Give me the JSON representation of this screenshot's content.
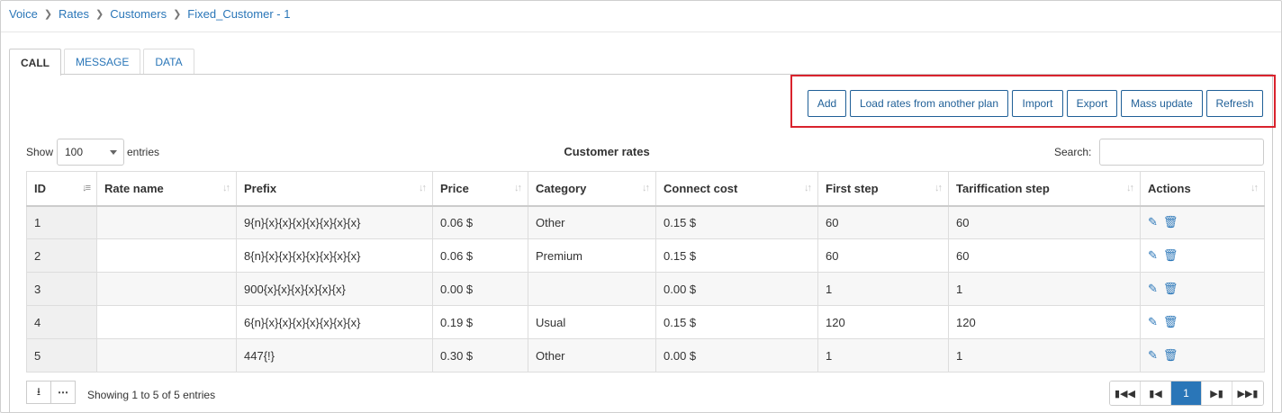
{
  "breadcrumb": [
    "Voice",
    "Rates",
    "Customers",
    "Fixed_Customer - 1"
  ],
  "tabs": [
    {
      "label": "CALL",
      "active": true
    },
    {
      "label": "MESSAGE",
      "active": false
    },
    {
      "label": "DATA",
      "active": false
    }
  ],
  "toolbar": {
    "add": "Add",
    "load": "Load rates from another plan",
    "import": "Import",
    "export": "Export",
    "mass_update": "Mass update",
    "refresh": "Refresh",
    "highlight_color": "#d9232d"
  },
  "table_controls": {
    "show_label": "Show",
    "page_size": "100",
    "entries_label": "entries",
    "title": "Customer rates",
    "search_label": "Search:",
    "search_value": ""
  },
  "columns": [
    "ID",
    "Rate name",
    "Prefix",
    "Price",
    "Category",
    "Connect cost",
    "First step",
    "Tariffication step",
    "Actions"
  ],
  "rows": [
    {
      "id": "1",
      "rate_name": "",
      "prefix": "9{n}{x}{x}{x}{x}{x}{x}{x}",
      "price": "0.06 $",
      "category": "Other",
      "connect_cost": "0.15 $",
      "first_step": "60",
      "tariffication_step": "60"
    },
    {
      "id": "2",
      "rate_name": "",
      "prefix": "8{n}{x}{x}{x}{x}{x}{x}{x}",
      "price": "0.06 $",
      "category": "Premium",
      "connect_cost": "0.15 $",
      "first_step": "60",
      "tariffication_step": "60"
    },
    {
      "id": "3",
      "rate_name": "",
      "prefix": "900{x}{x}{x}{x}{x}{x}",
      "price": "0.00 $",
      "category": "",
      "connect_cost": "0.00 $",
      "first_step": "1",
      "tariffication_step": "1"
    },
    {
      "id": "4",
      "rate_name": "",
      "prefix": "6{n}{x}{x}{x}{x}{x}{x}{x}",
      "price": "0.19 $",
      "category": "Usual",
      "connect_cost": "0.15 $",
      "first_step": "120",
      "tariffication_step": "120"
    },
    {
      "id": "5",
      "rate_name": "",
      "prefix": "447{!}",
      "price": "0.30 $",
      "category": "Other",
      "connect_cost": "0.00 $",
      "first_step": "1",
      "tariffication_step": "1"
    }
  ],
  "row_actions": [
    "edit-icon",
    "delete-icon"
  ],
  "footer": {
    "showing": "Showing 1 to 5 of 5 entries",
    "current_page": "1"
  },
  "colors": {
    "accent": "#2a76b8"
  }
}
